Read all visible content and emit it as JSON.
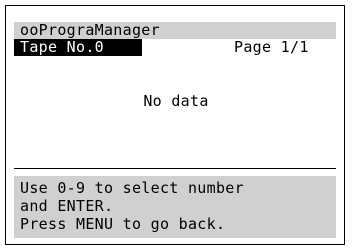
{
  "header": {
    "title": "ooPrograManager",
    "tape_label": "Tape No.0",
    "page_indicator": "Page 1/1"
  },
  "main": {
    "empty_message": "No data"
  },
  "help": {
    "lines": [
      "Use 0-9 to select number",
      "and ENTER.",
      "Press MENU to go back."
    ]
  },
  "colors": {
    "background": "#ffffff",
    "panel_gray": "#d0d0d0",
    "text": "#000000",
    "highlight": "#000000"
  }
}
